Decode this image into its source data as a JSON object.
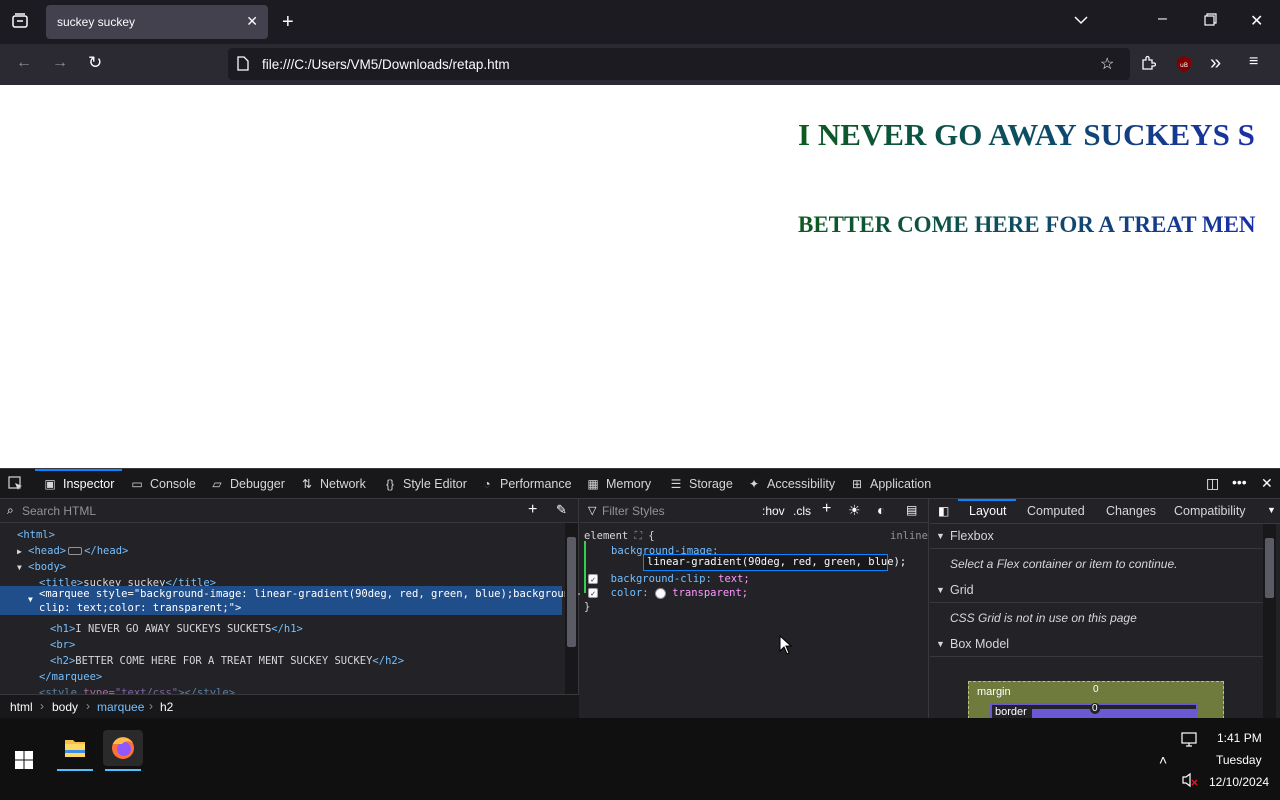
{
  "browser": {
    "tab_title": "suckey suckey",
    "url": "file:///C:/Users/VM5/Downloads/retap.htm"
  },
  "page": {
    "h1": "I NEVER GO AWAY SUCKEYS S",
    "h2": "BETTER COME HERE FOR A TREAT MEN"
  },
  "devtools": {
    "tabs": [
      "Inspector",
      "Console",
      "Debugger",
      "Network",
      "Style Editor",
      "Performance",
      "Memory",
      "Storage",
      "Accessibility",
      "Application"
    ],
    "markup": {
      "search_placeholder": "Search HTML",
      "lines": {
        "html": "<html>",
        "head": "<head>",
        "head_close": "</head>",
        "body": "<body>",
        "title_open": "<title>",
        "title_text": "suckey suckey",
        "title_close": "</title>",
        "marquee_tag": "<marquee",
        "marquee_attr": " style=",
        "marquee_val1": "\"background-image: linear-gradient(90deg, red, green, blue);background-",
        "marquee_val2": "clip: text;color: transparent;\"",
        "marquee_end": ">",
        "h1_open": "<h1>",
        "h1_text": "I NEVER GO AWAY SUCKEYS SUCKETS",
        "h1_close": "</h1>",
        "br": "<br>",
        "h2_open": "<h2>",
        "h2_text": "BETTER COME HERE FOR A TREAT MENT SUCKEY SUCKEY",
        "h2_close": "</h2>",
        "marquee_close": "</marquee>",
        "style_tag": "<style",
        "style_attr": " type=",
        "style_val": "\"text/css\"",
        "style_end": "></style>"
      },
      "breadcrumbs": [
        "html",
        "body",
        "marquee",
        "h2"
      ]
    },
    "rules": {
      "filter_placeholder": "Filter Styles",
      "hov": ":hov",
      "cls": ".cls",
      "selector": "element",
      "brace_open": "{",
      "brace_close": "}",
      "source": "inline",
      "decls": {
        "p1": "background-image:",
        "p1_value": "linear-gradient(90deg, red, green, blue);",
        "p2": "background-clip:",
        "p2_value": "text;",
        "p3": "color:",
        "p3_value": "transparent;"
      }
    },
    "sidebar": {
      "tabs": [
        "Layout",
        "Computed",
        "Changes",
        "Compatibility"
      ],
      "sections": {
        "flexbox": "Flexbox",
        "flexbox_msg": "Select a Flex container or item to continue.",
        "grid": "Grid",
        "grid_msg": "CSS Grid is not in use on this page",
        "boxmodel": "Box Model"
      },
      "boxmodel": {
        "margin_label": "margin",
        "margin_value": "0",
        "border_label": "border",
        "border_value": "0"
      }
    }
  },
  "taskbar": {
    "time": "1:41 PM",
    "day": "Tuesday",
    "date": "12/10/2024"
  },
  "colors": {
    "accent": "#0a84ff",
    "selected_row": "#204e8a",
    "toolbar_bg": "#2b2a33",
    "taskbar_bg": "#101010"
  }
}
